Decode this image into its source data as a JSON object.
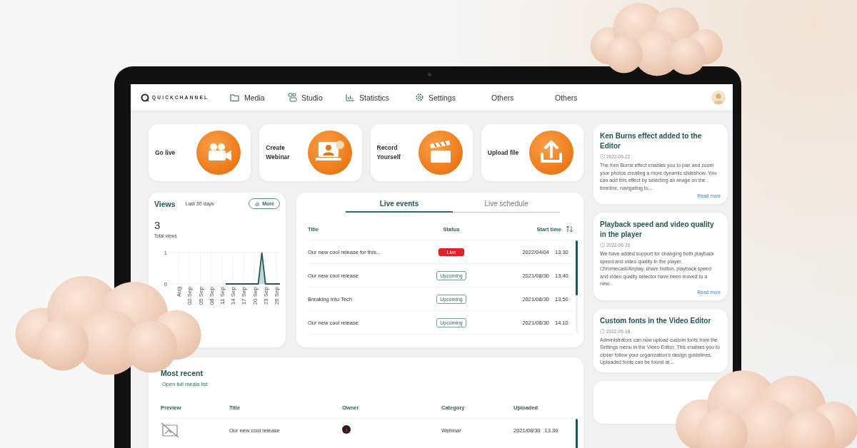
{
  "nav": {
    "logo": "QUICKCHANNEL",
    "items": [
      {
        "label": "Media"
      },
      {
        "label": "Studio"
      },
      {
        "label": "Statistics"
      },
      {
        "label": "Settings"
      },
      {
        "label": "Others"
      },
      {
        "label": "Others"
      }
    ]
  },
  "actions": [
    {
      "label": "Go live"
    },
    {
      "label": "Create Webinar"
    },
    {
      "label": "Record Yourself"
    },
    {
      "label": "Upload file"
    }
  ],
  "views": {
    "title": "Views",
    "period": "Last 30 days",
    "more": "More",
    "total": "3",
    "total_label": "Total views",
    "chart_data": {
      "type": "area",
      "grid": true,
      "categories": [
        null,
        null,
        "Aug",
        null,
        null,
        "02 Sep",
        null,
        null,
        "05 Sep",
        null,
        null,
        "08 Sep",
        null,
        null,
        "11 Sep",
        null,
        null,
        "14 Sep",
        null,
        null,
        "17 Sep",
        null,
        null,
        "20 Sep",
        null,
        null,
        "23 Sep",
        null,
        null,
        "26 Sep",
        null
      ],
      "series": [
        {
          "color": "#1f5c5a",
          "values": [
            null,
            null,
            null,
            null,
            null,
            null,
            null,
            null,
            null,
            null,
            null,
            null,
            null,
            null,
            null,
            0,
            0,
            0,
            0,
            0,
            0,
            0,
            0,
            0,
            0,
            1,
            0,
            0,
            0,
            0,
            0
          ]
        }
      ],
      "ylim": [
        0,
        1
      ],
      "yticks": [
        0,
        1
      ]
    }
  },
  "live": {
    "tabs": [
      {
        "label": "Live events",
        "selected": true
      },
      {
        "label": "Live schedule",
        "selected": false
      }
    ],
    "columns": [
      "Title",
      "Status",
      "Start time"
    ],
    "rows": [
      {
        "title": "Our new cool release for this...",
        "status": "Live",
        "kind": "live",
        "date": "2022/04/04",
        "time": "13.30"
      },
      {
        "title": "Our new cool release",
        "status": "Upcoming",
        "kind": "upcoming",
        "date": "2021/08/30",
        "time": "13.40"
      },
      {
        "title": "Breaking Into Tech",
        "status": "Upcoming",
        "kind": "upcoming",
        "date": "2021/08/30",
        "time": "13.50"
      },
      {
        "title": "Our new cool release",
        "status": "Upcoming",
        "kind": "upcoming",
        "date": "2021/08/30",
        "time": "14.10"
      }
    ]
  },
  "recent": {
    "title": "Most recent",
    "link": "Open full media list",
    "columns": [
      "Preview",
      "Title",
      "Owner",
      "Category",
      "Uploaded"
    ],
    "rows": [
      {
        "title": "Our new cool release",
        "category": "Webinar",
        "date": "2021/08/30",
        "time": "13.30"
      }
    ]
  },
  "news": [
    {
      "title": "Ken Burns effect added to the Editor",
      "date": "2022-09-22",
      "body": "The Ken Burns effect enables you to pan and zoom your photos creating a more dynamic slideshow. You can add this effect by selecting an image on the timeline, navigating to...",
      "read_more": "Read more"
    },
    {
      "title": "Playback speed and video quality in the player",
      "date": "2022-06-28",
      "body": "We have added support for changing both playback speed and video quality in the player. Chromecast/Airplay, share button, playback speed and video quality selector have been moved to a new...",
      "read_more": "Read more"
    },
    {
      "title": "Custom fonts in the Video Editor",
      "date": "2022-06-16",
      "body": "Administrators can now upload custom fonts from the Settings menu in the Video Editor. This enables you to closer follow your organization's design guidelines. Uploaded fonts can be found at..."
    }
  ]
}
